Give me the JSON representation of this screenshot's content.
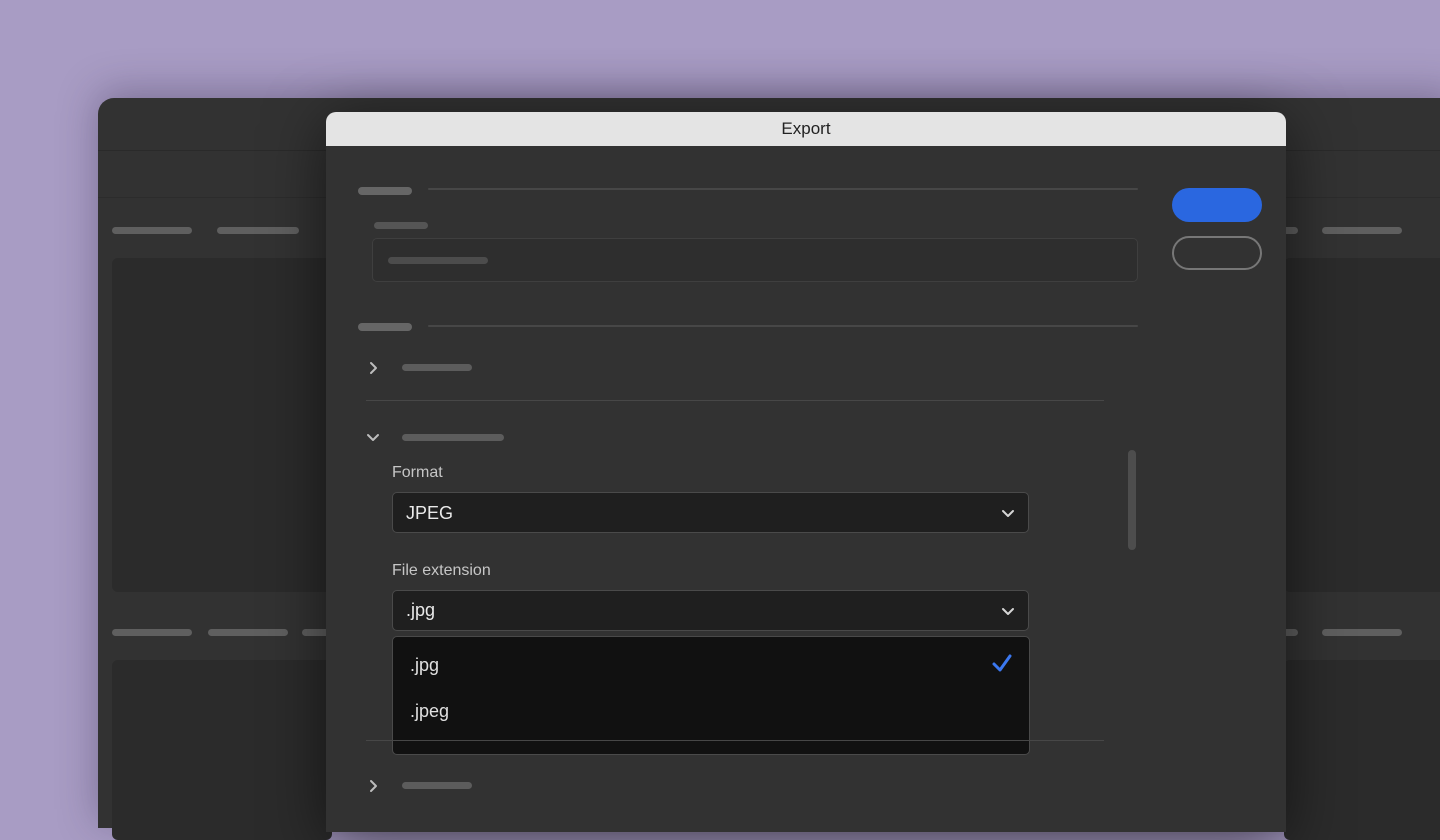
{
  "dialog": {
    "title": "Export"
  },
  "format": {
    "label": "Format",
    "value": "JPEG"
  },
  "file_extension": {
    "label": "File extension",
    "value": ".jpg",
    "options": [
      {
        "label": ".jpg",
        "selected": true
      },
      {
        "label": ".jpeg",
        "selected": false
      }
    ]
  },
  "colors": {
    "accent": "#2a67e0",
    "dialog_background": "#323232",
    "titlebar": "#e4e4e4",
    "page_background": "#a89cc4"
  },
  "icons": {
    "collapsed": "chevron-right-icon",
    "expanded": "chevron-down-icon",
    "dropdown": "chevron-down-icon",
    "selected": "checkmark-icon"
  }
}
